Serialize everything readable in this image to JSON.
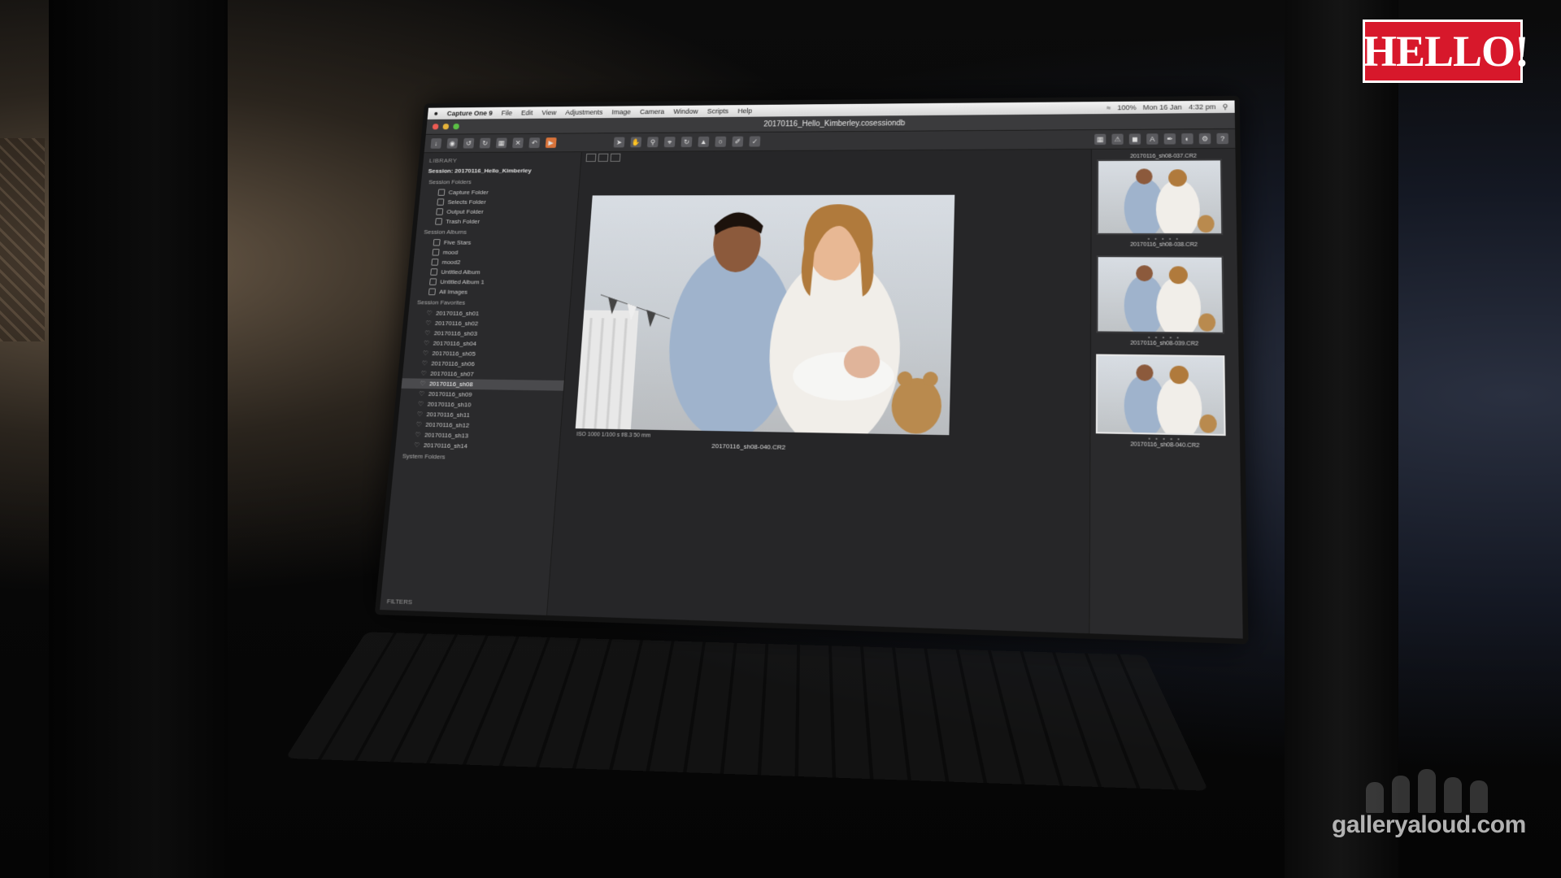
{
  "menubar": {
    "apple": "",
    "app_name": "Capture One 9",
    "items": [
      "File",
      "Edit",
      "View",
      "Adjustments",
      "Image",
      "Camera",
      "Window",
      "Scripts",
      "Help"
    ],
    "status": {
      "battery": "100%",
      "date": "Mon 16 Jan",
      "time": "4:32 pm"
    }
  },
  "window": {
    "title": "20170116_Hello_Kimberley.cosessiondb"
  },
  "library": {
    "header": "LIBRARY",
    "session_name": "Session: 20170116_Hello_Kimberley",
    "session_folders_title": "Session Folders",
    "session_folders": [
      "Capture Folder",
      "Selects Folder",
      "Output Folder",
      "Trash Folder"
    ],
    "session_albums_title": "Session Albums",
    "session_albums": [
      "Five Stars",
      "mood",
      "mood2",
      "Untitled Album",
      "Untitled Album 1",
      "All Images"
    ],
    "session_favorites_title": "Session Favorites",
    "session_favorites": [
      "20170116_sh01",
      "20170116_sh02",
      "20170116_sh03",
      "20170116_sh04",
      "20170116_sh05",
      "20170116_sh06",
      "20170116_sh07",
      "20170116_sh08",
      "20170116_sh09",
      "20170116_sh10",
      "20170116_sh11",
      "20170116_sh12",
      "20170116_sh13",
      "20170116_sh14"
    ],
    "selected_favorite": "20170116_sh08",
    "system_folders_title": "System Folders",
    "filters_label": "FILTERS"
  },
  "viewer": {
    "capture_info": "ISO 1000   1/100 s   f/8.3   50 mm",
    "image_name": "20170116_sh08-040.CR2"
  },
  "browser": {
    "header_name": "20170116_sh08-037.CR2",
    "thumbnails": [
      {
        "name": "20170116_sh08-038.CR2",
        "stars": "• • • • •"
      },
      {
        "name": "20170116_sh08-039.CR2",
        "stars": "• • • • •"
      },
      {
        "name": "20170116_sh08-040.CR2",
        "stars": "• • • • •"
      }
    ]
  },
  "overlays": {
    "logo": "HELLO!",
    "watermark": "galleryaloud.com"
  }
}
